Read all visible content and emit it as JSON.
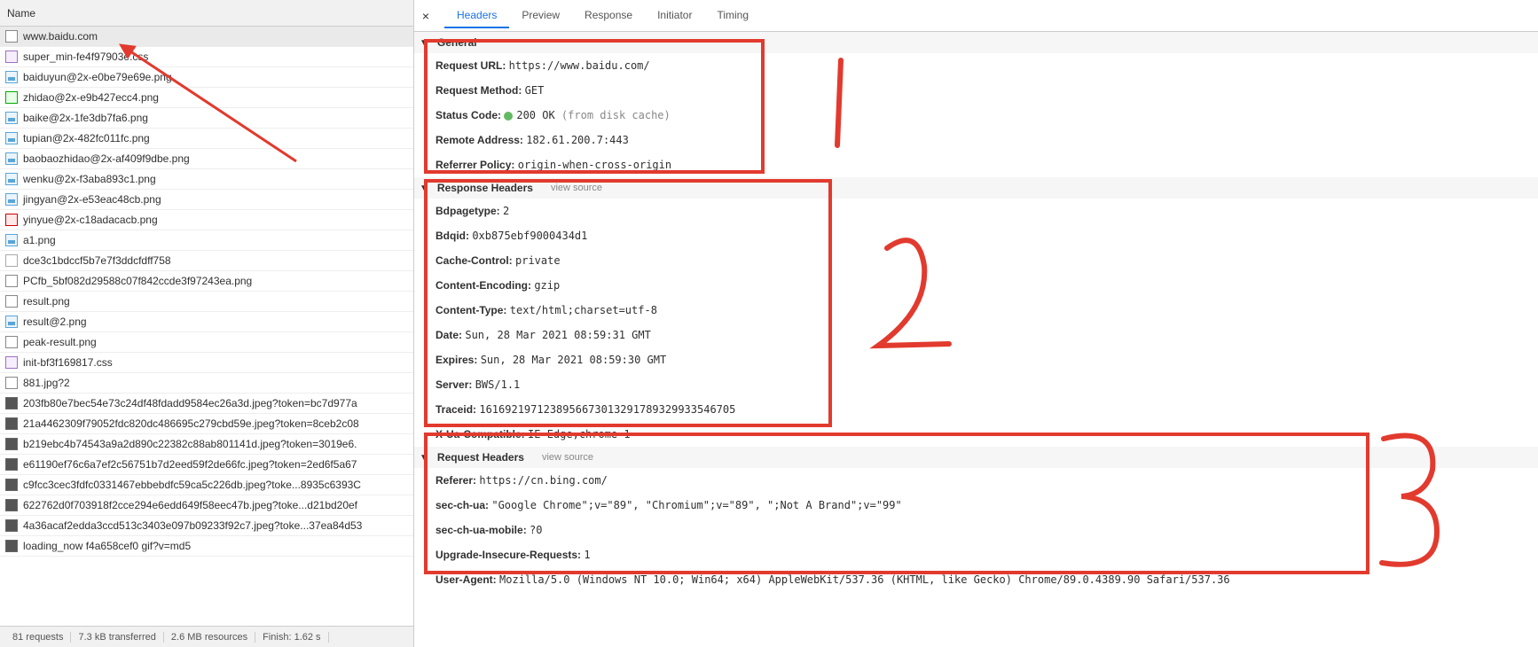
{
  "left_header": "Name",
  "selected_file": "www.baidu.com",
  "files": [
    {
      "name": "www.baidu.com",
      "ico": "ico-doc",
      "sel": true
    },
    {
      "name": "super_min-fe4f97903e.css",
      "ico": "ico-css"
    },
    {
      "name": "baiduyun@2x-e0be79e69e.png",
      "ico": "ico-img"
    },
    {
      "name": "zhidao@2x-e9b427ecc4.png",
      "ico": "ico-green"
    },
    {
      "name": "baike@2x-1fe3db7fa6.png",
      "ico": "ico-img"
    },
    {
      "name": "tupian@2x-482fc011fc.png",
      "ico": "ico-img"
    },
    {
      "name": "baobaozhidao@2x-af409f9dbe.png",
      "ico": "ico-img"
    },
    {
      "name": "wenku@2x-f3aba893c1.png",
      "ico": "ico-img"
    },
    {
      "name": "jingyan@2x-e53eac48cb.png",
      "ico": "ico-img"
    },
    {
      "name": "yinyue@2x-c18adacacb.png",
      "ico": "ico-red"
    },
    {
      "name": "a1.png",
      "ico": "ico-img"
    },
    {
      "name": "dce3c1bdccf5b7e7f3ddcfdff758",
      "ico": "ico-js"
    },
    {
      "name": "PCfb_5bf082d29588c07f842ccde3f97243ea.png",
      "ico": "ico-doc"
    },
    {
      "name": "result.png",
      "ico": "ico-doc"
    },
    {
      "name": "result@2.png",
      "ico": "ico-img"
    },
    {
      "name": "peak-result.png",
      "ico": "ico-doc"
    },
    {
      "name": "init-bf3f169817.css",
      "ico": "ico-css"
    },
    {
      "name": "881.jpg?2",
      "ico": "ico-doc"
    },
    {
      "name": "203fb80e7bec54e73c24df48fdadd9584ec26a3d.jpeg?token=bc7d977a",
      "ico": "ico-media"
    },
    {
      "name": "21a4462309f79052fdc820dc486695c279cbd59e.jpeg?token=8ceb2c08",
      "ico": "ico-media"
    },
    {
      "name": "b219ebc4b74543a9a2d890c22382c88ab801141d.jpeg?token=3019e6.",
      "ico": "ico-media"
    },
    {
      "name": "e61190ef76c6a7ef2c56751b7d2eed59f2de66fc.jpeg?token=2ed6f5a67",
      "ico": "ico-media"
    },
    {
      "name": "c9fcc3cec3fdfc0331467ebbebdfc59ca5c226db.jpeg?toke...8935c6393C",
      "ico": "ico-media"
    },
    {
      "name": "622762d0f703918f2cce294e6edd649f58eec47b.jpeg?toke...d21bd20ef",
      "ico": "ico-media"
    },
    {
      "name": "4a36acaf2edda3ccd513c3403e097b09233f92c7.jpeg?toke...37ea84d53",
      "ico": "ico-media"
    },
    {
      "name": "loading_now f4a658cef0 gif?v=md5",
      "ico": "ico-media"
    }
  ],
  "status_bar": [
    "81 requests",
    "7.3 kB transferred",
    "2.6 MB resources",
    "Finish: 1.62 s"
  ],
  "tabs": [
    "Headers",
    "Preview",
    "Response",
    "Initiator",
    "Timing"
  ],
  "active_tab": "Headers",
  "general": {
    "title": "General",
    "items": [
      {
        "k": "Request URL:",
        "v": "https://www.baidu.com/"
      },
      {
        "k": "Request Method:",
        "v": "GET"
      },
      {
        "k": "Status Code:",
        "v": "200 OK (from disk cache)",
        "status": true
      },
      {
        "k": "Remote Address:",
        "v": "182.61.200.7:443"
      },
      {
        "k": "Referrer Policy:",
        "v": "origin-when-cross-origin"
      }
    ]
  },
  "resp": {
    "title": "Response Headers",
    "view_source": "view source",
    "items": [
      {
        "k": "Bdpagetype:",
        "v": "2"
      },
      {
        "k": "Bdqid:",
        "v": "0xb875ebf9000434d1"
      },
      {
        "k": "Cache-Control:",
        "v": "private"
      },
      {
        "k": "Content-Encoding:",
        "v": "gzip"
      },
      {
        "k": "Content-Type:",
        "v": "text/html;charset=utf-8"
      },
      {
        "k": "Date:",
        "v": "Sun, 28 Mar 2021 08:59:31 GMT"
      },
      {
        "k": "Expires:",
        "v": "Sun, 28 Mar 2021 08:59:30 GMT"
      },
      {
        "k": "Server:",
        "v": "BWS/1.1"
      },
      {
        "k": "Traceid:",
        "v": "1616921971238956673013291789329933546705"
      },
      {
        "k": "X-Ua-Compatible:",
        "v": "IE=Edge,chrome=1"
      }
    ]
  },
  "req": {
    "title": "Request Headers",
    "view_source": "view source",
    "items": [
      {
        "k": "Referer:",
        "v": "https://cn.bing.com/"
      },
      {
        "k": "sec-ch-ua:",
        "v": "\"Google Chrome\";v=\"89\", \"Chromium\";v=\"89\", \";Not A Brand\";v=\"99\""
      },
      {
        "k": "sec-ch-ua-mobile:",
        "v": "?0"
      },
      {
        "k": "Upgrade-Insecure-Requests:",
        "v": "1"
      },
      {
        "k": "User-Agent:",
        "v": "Mozilla/5.0 (Windows NT 10.0; Win64; x64) AppleWebKit/537.36 (KHTML, like Gecko) Chrome/89.0.4389.90 Safari/537.36"
      }
    ]
  },
  "annotations": [
    "1",
    "2",
    "3"
  ]
}
